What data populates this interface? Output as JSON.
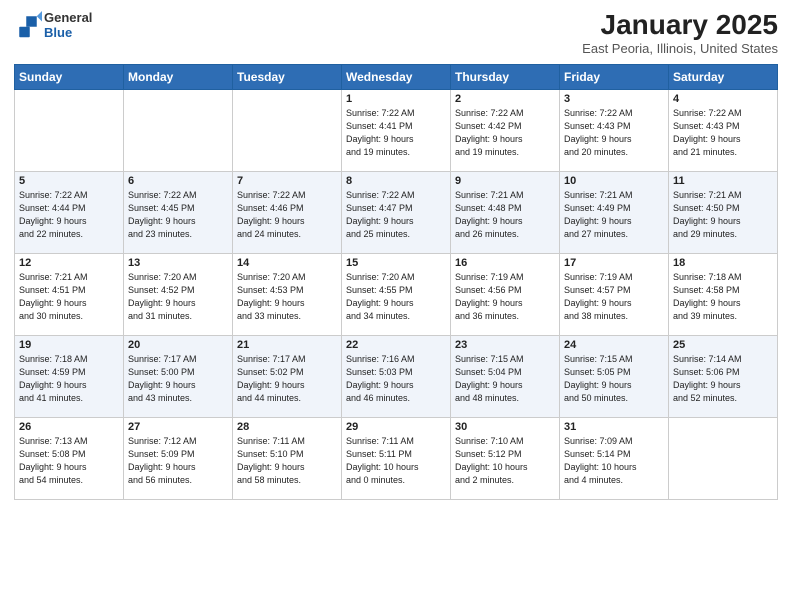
{
  "header": {
    "logo_general": "General",
    "logo_blue": "Blue",
    "month": "January 2025",
    "location": "East Peoria, Illinois, United States"
  },
  "days_of_week": [
    "Sunday",
    "Monday",
    "Tuesday",
    "Wednesday",
    "Thursday",
    "Friday",
    "Saturday"
  ],
  "weeks": [
    [
      {
        "day": "",
        "sunrise": "",
        "sunset": "",
        "daylight": ""
      },
      {
        "day": "",
        "sunrise": "",
        "sunset": "",
        "daylight": ""
      },
      {
        "day": "",
        "sunrise": "",
        "sunset": "",
        "daylight": ""
      },
      {
        "day": "1",
        "sunrise": "Sunrise: 7:22 AM",
        "sunset": "Sunset: 4:41 PM",
        "daylight": "Daylight: 9 hours and 19 minutes."
      },
      {
        "day": "2",
        "sunrise": "Sunrise: 7:22 AM",
        "sunset": "Sunset: 4:42 PM",
        "daylight": "Daylight: 9 hours and 19 minutes."
      },
      {
        "day": "3",
        "sunrise": "Sunrise: 7:22 AM",
        "sunset": "Sunset: 4:43 PM",
        "daylight": "Daylight: 9 hours and 20 minutes."
      },
      {
        "day": "4",
        "sunrise": "Sunrise: 7:22 AM",
        "sunset": "Sunset: 4:43 PM",
        "daylight": "Daylight: 9 hours and 21 minutes."
      }
    ],
    [
      {
        "day": "5",
        "sunrise": "Sunrise: 7:22 AM",
        "sunset": "Sunset: 4:44 PM",
        "daylight": "Daylight: 9 hours and 22 minutes."
      },
      {
        "day": "6",
        "sunrise": "Sunrise: 7:22 AM",
        "sunset": "Sunset: 4:45 PM",
        "daylight": "Daylight: 9 hours and 23 minutes."
      },
      {
        "day": "7",
        "sunrise": "Sunrise: 7:22 AM",
        "sunset": "Sunset: 4:46 PM",
        "daylight": "Daylight: 9 hours and 24 minutes."
      },
      {
        "day": "8",
        "sunrise": "Sunrise: 7:22 AM",
        "sunset": "Sunset: 4:47 PM",
        "daylight": "Daylight: 9 hours and 25 minutes."
      },
      {
        "day": "9",
        "sunrise": "Sunrise: 7:21 AM",
        "sunset": "Sunset: 4:48 PM",
        "daylight": "Daylight: 9 hours and 26 minutes."
      },
      {
        "day": "10",
        "sunrise": "Sunrise: 7:21 AM",
        "sunset": "Sunset: 4:49 PM",
        "daylight": "Daylight: 9 hours and 27 minutes."
      },
      {
        "day": "11",
        "sunrise": "Sunrise: 7:21 AM",
        "sunset": "Sunset: 4:50 PM",
        "daylight": "Daylight: 9 hours and 29 minutes."
      }
    ],
    [
      {
        "day": "12",
        "sunrise": "Sunrise: 7:21 AM",
        "sunset": "Sunset: 4:51 PM",
        "daylight": "Daylight: 9 hours and 30 minutes."
      },
      {
        "day": "13",
        "sunrise": "Sunrise: 7:20 AM",
        "sunset": "Sunset: 4:52 PM",
        "daylight": "Daylight: 9 hours and 31 minutes."
      },
      {
        "day": "14",
        "sunrise": "Sunrise: 7:20 AM",
        "sunset": "Sunset: 4:53 PM",
        "daylight": "Daylight: 9 hours and 33 minutes."
      },
      {
        "day": "15",
        "sunrise": "Sunrise: 7:20 AM",
        "sunset": "Sunset: 4:55 PM",
        "daylight": "Daylight: 9 hours and 34 minutes."
      },
      {
        "day": "16",
        "sunrise": "Sunrise: 7:19 AM",
        "sunset": "Sunset: 4:56 PM",
        "daylight": "Daylight: 9 hours and 36 minutes."
      },
      {
        "day": "17",
        "sunrise": "Sunrise: 7:19 AM",
        "sunset": "Sunset: 4:57 PM",
        "daylight": "Daylight: 9 hours and 38 minutes."
      },
      {
        "day": "18",
        "sunrise": "Sunrise: 7:18 AM",
        "sunset": "Sunset: 4:58 PM",
        "daylight": "Daylight: 9 hours and 39 minutes."
      }
    ],
    [
      {
        "day": "19",
        "sunrise": "Sunrise: 7:18 AM",
        "sunset": "Sunset: 4:59 PM",
        "daylight": "Daylight: 9 hours and 41 minutes."
      },
      {
        "day": "20",
        "sunrise": "Sunrise: 7:17 AM",
        "sunset": "Sunset: 5:00 PM",
        "daylight": "Daylight: 9 hours and 43 minutes."
      },
      {
        "day": "21",
        "sunrise": "Sunrise: 7:17 AM",
        "sunset": "Sunset: 5:02 PM",
        "daylight": "Daylight: 9 hours and 44 minutes."
      },
      {
        "day": "22",
        "sunrise": "Sunrise: 7:16 AM",
        "sunset": "Sunset: 5:03 PM",
        "daylight": "Daylight: 9 hours and 46 minutes."
      },
      {
        "day": "23",
        "sunrise": "Sunrise: 7:15 AM",
        "sunset": "Sunset: 5:04 PM",
        "daylight": "Daylight: 9 hours and 48 minutes."
      },
      {
        "day": "24",
        "sunrise": "Sunrise: 7:15 AM",
        "sunset": "Sunset: 5:05 PM",
        "daylight": "Daylight: 9 hours and 50 minutes."
      },
      {
        "day": "25",
        "sunrise": "Sunrise: 7:14 AM",
        "sunset": "Sunset: 5:06 PM",
        "daylight": "Daylight: 9 hours and 52 minutes."
      }
    ],
    [
      {
        "day": "26",
        "sunrise": "Sunrise: 7:13 AM",
        "sunset": "Sunset: 5:08 PM",
        "daylight": "Daylight: 9 hours and 54 minutes."
      },
      {
        "day": "27",
        "sunrise": "Sunrise: 7:12 AM",
        "sunset": "Sunset: 5:09 PM",
        "daylight": "Daylight: 9 hours and 56 minutes."
      },
      {
        "day": "28",
        "sunrise": "Sunrise: 7:11 AM",
        "sunset": "Sunset: 5:10 PM",
        "daylight": "Daylight: 9 hours and 58 minutes."
      },
      {
        "day": "29",
        "sunrise": "Sunrise: 7:11 AM",
        "sunset": "Sunset: 5:11 PM",
        "daylight": "Daylight: 10 hours and 0 minutes."
      },
      {
        "day": "30",
        "sunrise": "Sunrise: 7:10 AM",
        "sunset": "Sunset: 5:12 PM",
        "daylight": "Daylight: 10 hours and 2 minutes."
      },
      {
        "day": "31",
        "sunrise": "Sunrise: 7:09 AM",
        "sunset": "Sunset: 5:14 PM",
        "daylight": "Daylight: 10 hours and 4 minutes."
      },
      {
        "day": "",
        "sunrise": "",
        "sunset": "",
        "daylight": ""
      }
    ]
  ]
}
